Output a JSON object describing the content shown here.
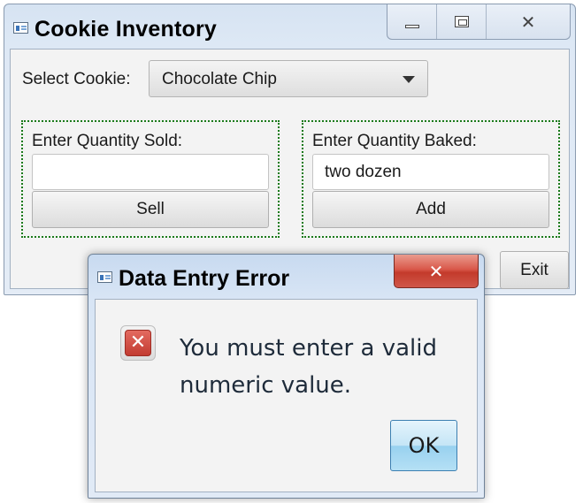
{
  "main_window": {
    "title": "Cookie Inventory",
    "select_label": "Select Cookie:",
    "selected_cookie": "Chocolate Chip",
    "sold_group": {
      "label": "Enter Quantity Sold:",
      "value": "",
      "button_label": "Sell"
    },
    "baked_group": {
      "label": "Enter Quantity Baked:",
      "value": "two dozen",
      "button_label": "Add"
    },
    "exit_label": "Exit"
  },
  "dialog": {
    "title": "Data Entry Error",
    "message_line1": "You must enter a valid",
    "message_line2": "numeric value.",
    "ok_label": "OK"
  },
  "icons": {
    "app": "window-app-icon",
    "minimize": "minimize-icon",
    "maximize": "maximize-icon",
    "close": "close-icon",
    "dropdown": "chevron-down-icon",
    "error": "error-x-icon"
  },
  "colors": {
    "group_border": "#1a7a1a",
    "dialog_close": "#c33a2b",
    "error_icon": "#c23b31",
    "ok_button": "#98d1ef"
  }
}
